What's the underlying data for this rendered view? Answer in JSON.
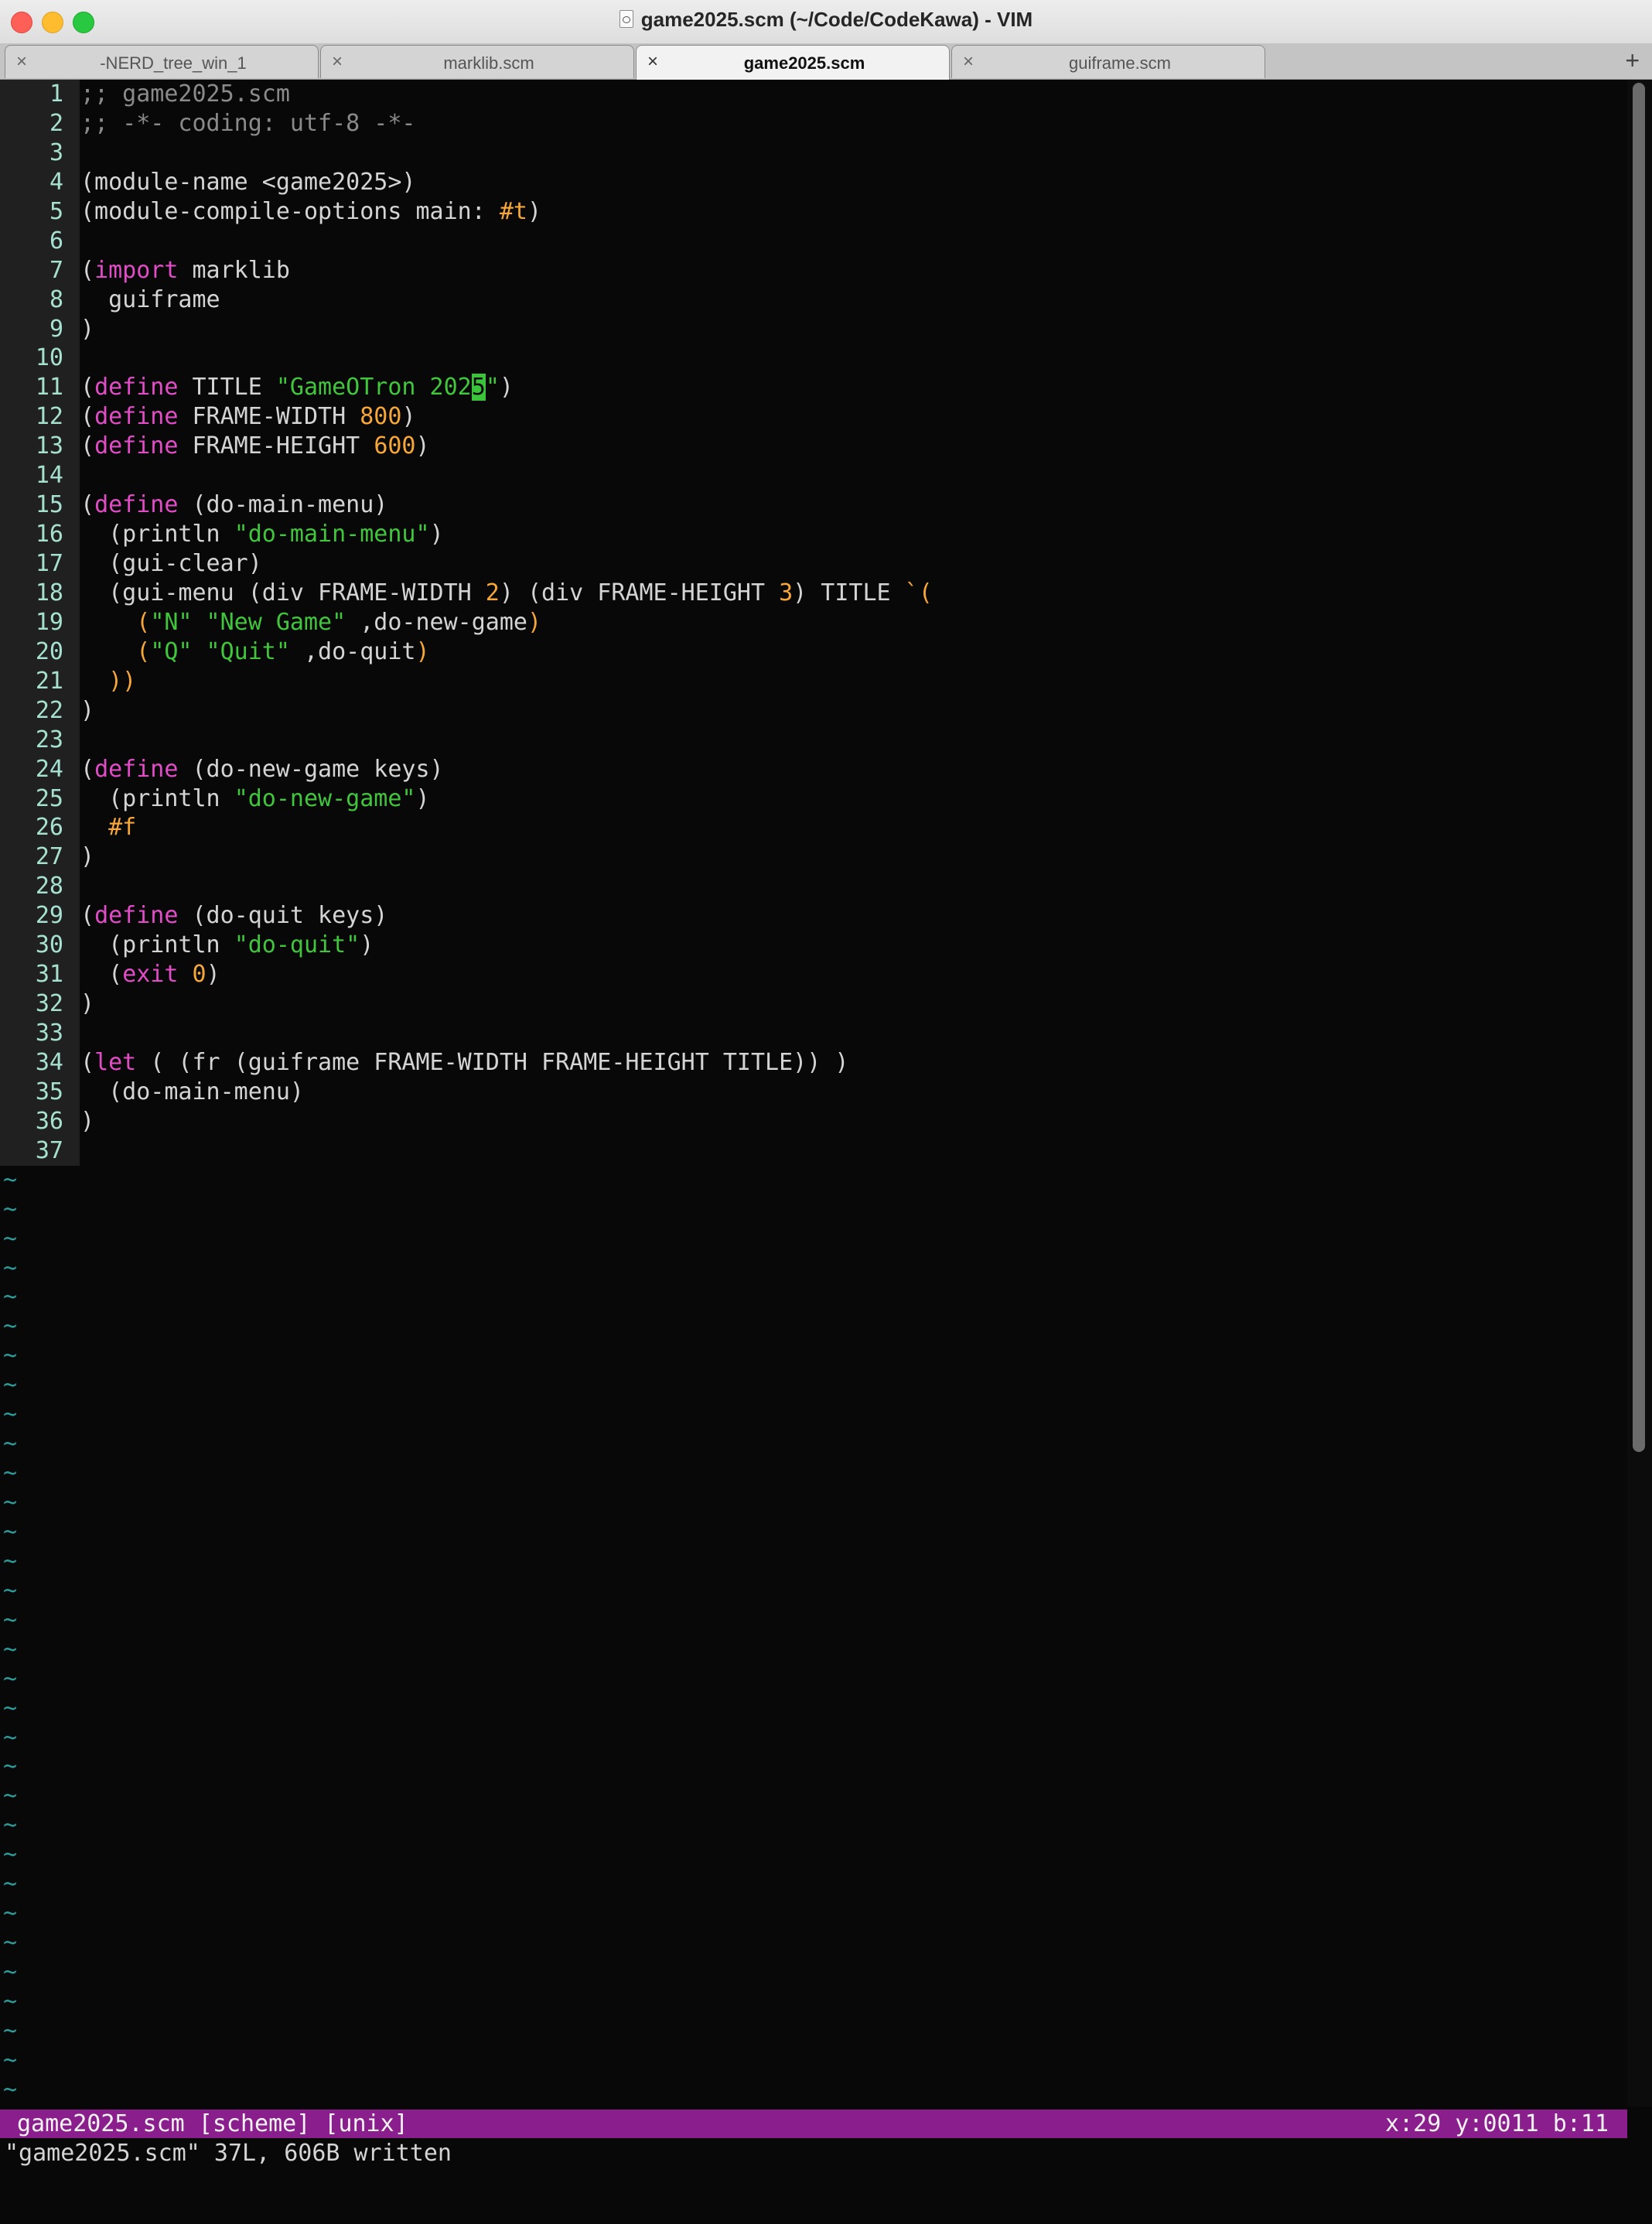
{
  "window": {
    "title": "game2025.scm (~/Code/CodeKawa) - VIM"
  },
  "tabs": [
    {
      "label": "-NERD_tree_win_1",
      "active": false
    },
    {
      "label": "marklib.scm",
      "active": false
    },
    {
      "label": "game2025.scm",
      "active": true
    },
    {
      "label": "guiframe.scm",
      "active": false
    }
  ],
  "tab_close_glyph": "×",
  "tab_add_glyph": "+",
  "editor": {
    "lines": [
      [
        {
          "t": ";; game2025.scm",
          "c": "comment"
        }
      ],
      [
        {
          "t": ";; -*- coding: utf-8 -*-",
          "c": "comment"
        }
      ],
      [],
      [
        {
          "t": "(module-name <game2025>)",
          "c": "text"
        }
      ],
      [
        {
          "t": "(module-compile-options main: ",
          "c": "text"
        },
        {
          "t": "#t",
          "c": "number"
        },
        {
          "t": ")",
          "c": "text"
        }
      ],
      [],
      [
        {
          "t": "(",
          "c": "text"
        },
        {
          "t": "import",
          "c": "keyword"
        },
        {
          "t": " marklib",
          "c": "text"
        }
      ],
      [
        {
          "t": "  guiframe",
          "c": "text"
        }
      ],
      [
        {
          "t": ")",
          "c": "text"
        }
      ],
      [],
      [
        {
          "t": "(",
          "c": "text"
        },
        {
          "t": "define",
          "c": "keyword"
        },
        {
          "t": " TITLE ",
          "c": "text"
        },
        {
          "t": "\"GameOTron 202",
          "c": "string"
        },
        {
          "t": "5",
          "c": "cursor"
        },
        {
          "t": "\"",
          "c": "string"
        },
        {
          "t": ")",
          "c": "text"
        }
      ],
      [
        {
          "t": "(",
          "c": "text"
        },
        {
          "t": "define",
          "c": "keyword"
        },
        {
          "t": " FRAME-WIDTH ",
          "c": "text"
        },
        {
          "t": "800",
          "c": "number"
        },
        {
          "t": ")",
          "c": "text"
        }
      ],
      [
        {
          "t": "(",
          "c": "text"
        },
        {
          "t": "define",
          "c": "keyword"
        },
        {
          "t": " FRAME-HEIGHT ",
          "c": "text"
        },
        {
          "t": "600",
          "c": "number"
        },
        {
          "t": ")",
          "c": "text"
        }
      ],
      [],
      [
        {
          "t": "(",
          "c": "text"
        },
        {
          "t": "define",
          "c": "keyword"
        },
        {
          "t": " (do-main-menu)",
          "c": "text"
        }
      ],
      [
        {
          "t": "  (println ",
          "c": "text"
        },
        {
          "t": "\"do-main-menu\"",
          "c": "string"
        },
        {
          "t": ")",
          "c": "text"
        }
      ],
      [
        {
          "t": "  (gui-clear)",
          "c": "text"
        }
      ],
      [
        {
          "t": "  (gui-menu (div FRAME-WIDTH ",
          "c": "text"
        },
        {
          "t": "2",
          "c": "number"
        },
        {
          "t": ") (div FRAME-HEIGHT ",
          "c": "text"
        },
        {
          "t": "3",
          "c": "number"
        },
        {
          "t": ") TITLE ",
          "c": "text"
        },
        {
          "t": "`(",
          "c": "tick"
        }
      ],
      [
        {
          "t": "    (",
          "c": "paren2"
        },
        {
          "t": "\"N\" \"New Game\"",
          "c": "string"
        },
        {
          "t": " ,do-new-game",
          "c": "text"
        },
        {
          "t": ")",
          "c": "paren2"
        }
      ],
      [
        {
          "t": "    (",
          "c": "paren2"
        },
        {
          "t": "\"Q\" \"Quit\"",
          "c": "string"
        },
        {
          "t": " ,do-quit",
          "c": "text"
        },
        {
          "t": ")",
          "c": "paren2"
        }
      ],
      [
        {
          "t": "  ))",
          "c": "paren2"
        }
      ],
      [
        {
          "t": ")",
          "c": "text"
        }
      ],
      [],
      [
        {
          "t": "(",
          "c": "text"
        },
        {
          "t": "define",
          "c": "keyword"
        },
        {
          "t": " (do-new-game keys)",
          "c": "text"
        }
      ],
      [
        {
          "t": "  (println ",
          "c": "text"
        },
        {
          "t": "\"do-new-game\"",
          "c": "string"
        },
        {
          "t": ")",
          "c": "text"
        }
      ],
      [
        {
          "t": "  #f",
          "c": "number"
        }
      ],
      [
        {
          "t": ")",
          "c": "text"
        }
      ],
      [],
      [
        {
          "t": "(",
          "c": "text"
        },
        {
          "t": "define",
          "c": "keyword"
        },
        {
          "t": " (do-quit keys)",
          "c": "text"
        }
      ],
      [
        {
          "t": "  (println ",
          "c": "text"
        },
        {
          "t": "\"do-quit\"",
          "c": "string"
        },
        {
          "t": ")",
          "c": "text"
        }
      ],
      [
        {
          "t": "  (",
          "c": "text"
        },
        {
          "t": "exit",
          "c": "keyword"
        },
        {
          "t": " ",
          "c": "text"
        },
        {
          "t": "0",
          "c": "number"
        },
        {
          "t": ")",
          "c": "text"
        }
      ],
      [
        {
          "t": ")",
          "c": "text"
        }
      ],
      [],
      [
        {
          "t": "(",
          "c": "text"
        },
        {
          "t": "let",
          "c": "keyword"
        },
        {
          "t": " ( (fr (guiframe FRAME-WIDTH FRAME-HEIGHT TITLE)) )",
          "c": "text"
        }
      ],
      [
        {
          "t": "  (do-main-menu)",
          "c": "text"
        }
      ],
      [
        {
          "t": ")",
          "c": "text"
        }
      ],
      []
    ],
    "empty_line_marker": "~",
    "empty_line_count": 32
  },
  "statusline": {
    "left": "game2025.scm [scheme] [unix]",
    "right": "x:29 y:0011 b:11"
  },
  "cmdline": {
    "message": "\"game2025.scm\" 37L, 606B written"
  },
  "colors": {
    "background": "#080808",
    "gutter": "#202020",
    "line_number": "#a6e1cf",
    "comment": "#8a8a8a",
    "keyword": "#e24cc7",
    "string": "#41c53c",
    "number": "#f6a737",
    "statusline": "#8a1e8d",
    "tilde": "#2b9d9a"
  }
}
